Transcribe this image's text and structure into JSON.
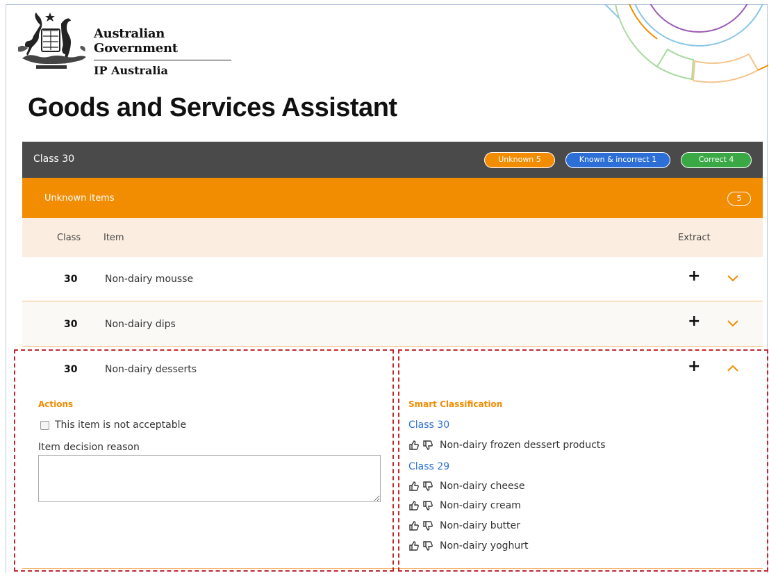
{
  "header": {
    "gov_name": "Australian Government",
    "agency": "IP Australia",
    "page_title": "Goods and Services Assistant"
  },
  "class_bar": {
    "title": "Class 30",
    "pill_unknown": "Unknown 5",
    "pill_known": "Known & incorrect 1",
    "pill_correct": "Correct 4",
    "colors": {
      "bar": "#4a4a4a",
      "unknown": "#f28c00",
      "known": "#2d6fd6",
      "correct": "#3aa845"
    }
  },
  "unknown_section": {
    "title": "Unknown items",
    "count": "5"
  },
  "table": {
    "headers": {
      "class": "Class",
      "item": "Item",
      "extract": "Extract"
    },
    "rows": [
      {
        "class": "30",
        "item": "Non-dairy mousse",
        "extract_icon": "plus-icon",
        "toggle_icon": "chevron-down-icon"
      },
      {
        "class": "30",
        "item": "Non-dairy dips",
        "extract_icon": "plus-icon",
        "toggle_icon": "chevron-down-icon"
      },
      {
        "class": "30",
        "item": "Non-dairy desserts",
        "extract_icon": "plus-icon",
        "toggle_icon": "chevron-up-icon"
      }
    ]
  },
  "expanded": {
    "actions_title": "Actions",
    "not_acceptable_label": "This item is not acceptable",
    "reason_label": "Item decision reason",
    "reason_value": "",
    "smart_title": "Smart Classification",
    "groups": [
      {
        "class": "Class 30",
        "items": [
          "Non-dairy frozen dessert products"
        ]
      },
      {
        "class": "Class 29",
        "items": [
          "Non-dairy cheese",
          "Non-dairy cream",
          "Non-dairy butter",
          "Non-dairy yoghurt"
        ]
      }
    ]
  }
}
